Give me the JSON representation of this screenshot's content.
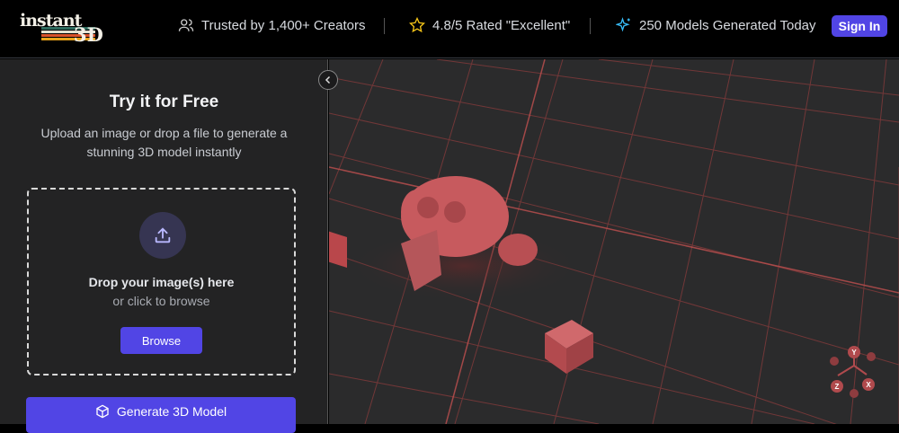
{
  "header": {
    "logo_text_top": "instant",
    "logo_text_bottom": "3D",
    "stats": [
      {
        "icon": "users-icon",
        "label": "Trusted by 1,400+ Creators"
      },
      {
        "icon": "star-icon",
        "label": "4.8/5 Rated \"Excellent\""
      },
      {
        "icon": "sparkles-icon",
        "label": "250 Models Generated Today"
      }
    ],
    "sign_in": "Sign In"
  },
  "panel": {
    "title": "Try it for Free",
    "subtitle": "Upload an image or drop a file to generate a stunning 3D model instantly",
    "drop_title": "Drop your image(s) here",
    "drop_sub": "or click to browse",
    "browse": "Browse",
    "generate": "Generate 3D Model"
  },
  "gizmo": {
    "y": "Y",
    "x": "X",
    "z": "Z"
  },
  "colors": {
    "accent": "#5145e5",
    "grid": "#b84a4a",
    "model": "#c75a5e"
  }
}
